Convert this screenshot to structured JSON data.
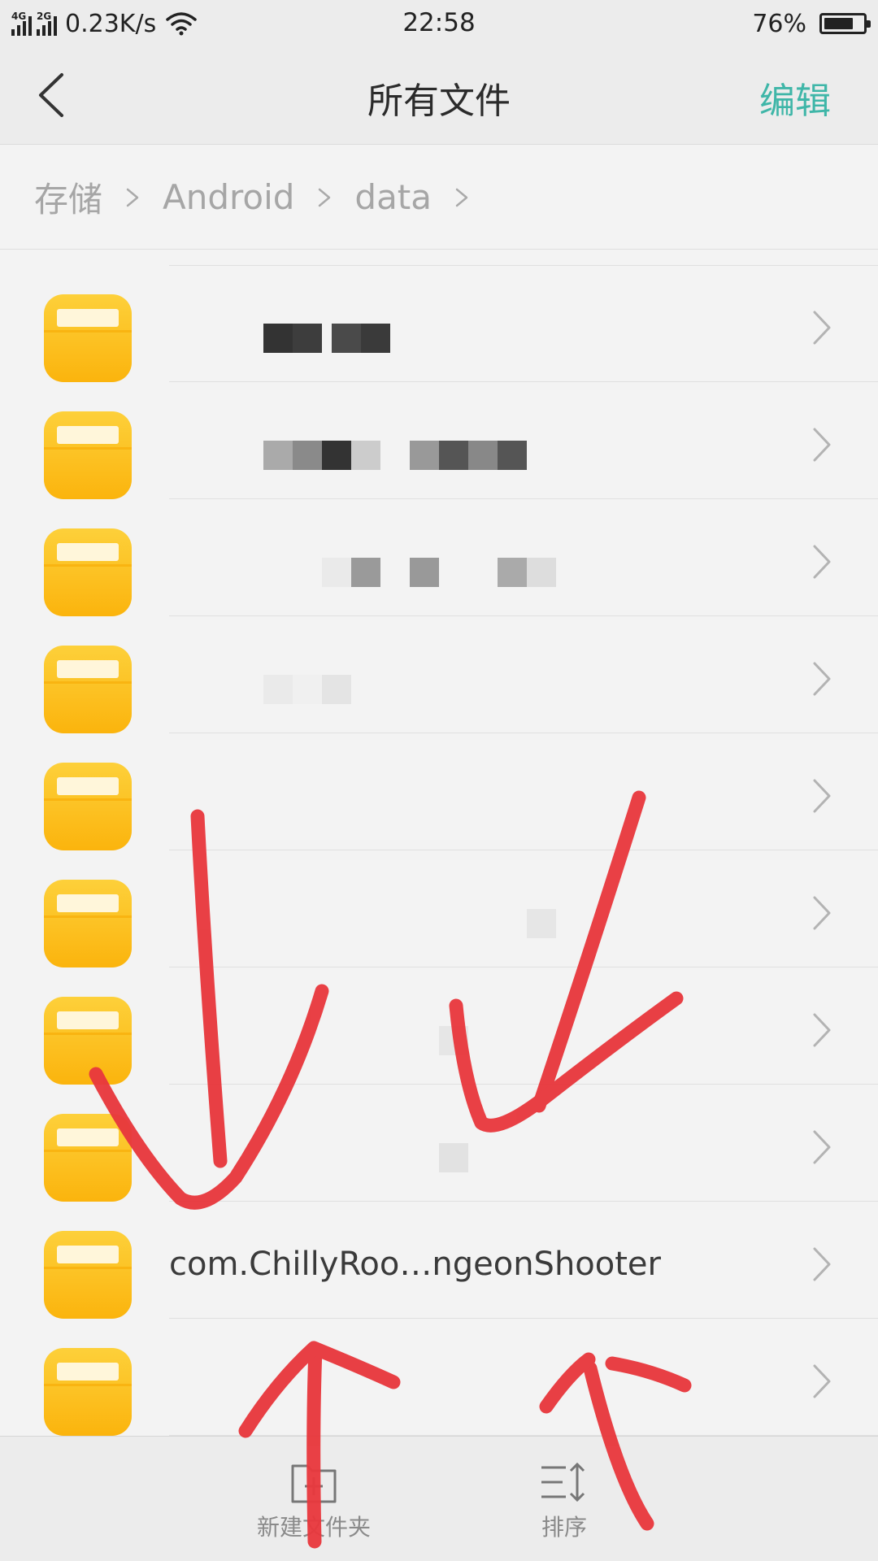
{
  "status_bar": {
    "network_1": "4G",
    "network_2": "2G",
    "speed": "0.23K/s",
    "time": "22:58",
    "battery_percent": "76%",
    "battery_level": 0.76
  },
  "header": {
    "title": "所有文件",
    "edit_label": "编辑"
  },
  "breadcrumb": [
    "存储",
    "Android",
    "data"
  ],
  "list": {
    "items": [
      {
        "label": ""
      },
      {
        "label": ""
      },
      {
        "label": ""
      },
      {
        "label": ""
      },
      {
        "label": ""
      },
      {
        "label": ""
      },
      {
        "label": ""
      },
      {
        "label": ""
      },
      {
        "label": "com.ChillyRoo…ngeonShooter"
      },
      {
        "label": ""
      }
    ]
  },
  "toolbar": {
    "new_folder_label": "新建文件夹",
    "sort_label": "排序"
  },
  "colors": {
    "accent": "#3fb6a8",
    "folder": "#fcb917",
    "annotation": "#e8383d"
  },
  "icons": [
    "back-arrow-icon",
    "chevron-right-icon",
    "folder-icon",
    "new-folder-icon",
    "sort-icon",
    "wifi-icon",
    "battery-icon",
    "signal-icon"
  ]
}
